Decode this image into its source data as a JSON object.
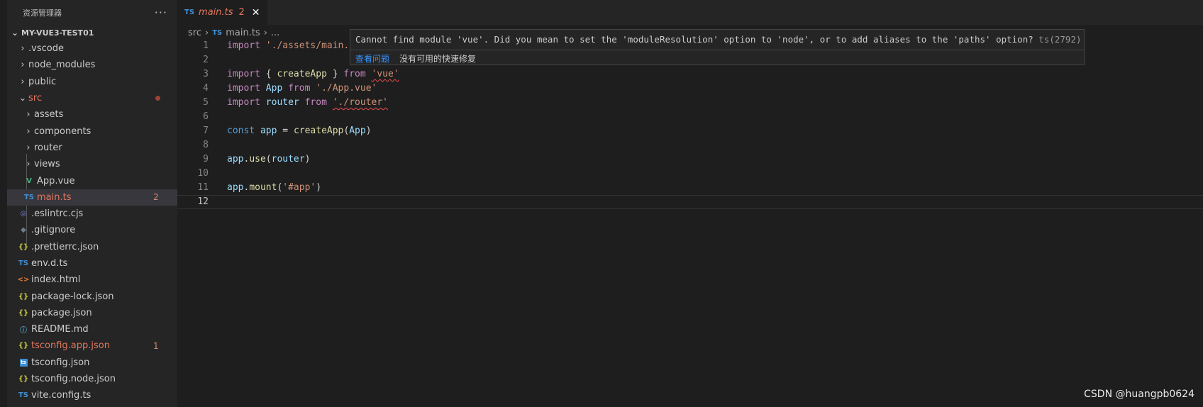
{
  "explorer": {
    "title": "资源管理器",
    "more": "···",
    "project": "MY-VUE3-TEST01",
    "items": [
      {
        "label": ".vscode",
        "type": "folder",
        "depth": 0
      },
      {
        "label": "node_modules",
        "type": "folder",
        "depth": 0
      },
      {
        "label": "public",
        "type": "folder",
        "depth": 0
      },
      {
        "label": "src",
        "type": "folder-open",
        "depth": 0
      },
      {
        "label": "assets",
        "type": "folder",
        "depth": 1
      },
      {
        "label": "components",
        "type": "folder",
        "depth": 1
      },
      {
        "label": "router",
        "type": "folder",
        "depth": 1
      },
      {
        "label": "views",
        "type": "folder",
        "depth": 1
      },
      {
        "label": "App.vue",
        "icon": "V",
        "depth": 1
      },
      {
        "label": "main.ts",
        "icon": "TS",
        "badge": "2",
        "depth": 1
      },
      {
        "label": ".eslintrc.cjs",
        "icon": "◎",
        "depth": 0
      },
      {
        "label": ".gitignore",
        "icon": "◆",
        "depth": 0
      },
      {
        "label": ".prettierrc.json",
        "icon": "{}",
        "depth": 0
      },
      {
        "label": "env.d.ts",
        "icon": "TS",
        "depth": 0
      },
      {
        "label": "index.html",
        "icon": "<>",
        "depth": 0
      },
      {
        "label": "package-lock.json",
        "icon": "{}",
        "depth": 0
      },
      {
        "label": "package.json",
        "icon": "{}",
        "depth": 0
      },
      {
        "label": "README.md",
        "icon": "ⓘ",
        "depth": 0
      },
      {
        "label": "tsconfig.app.json",
        "icon": "{}",
        "badge": "1",
        "depth": 0
      },
      {
        "label": "tsconfig.json",
        "icon": "ts",
        "depth": 0
      },
      {
        "label": "tsconfig.node.json",
        "icon": "{}",
        "depth": 0
      },
      {
        "label": "vite.config.ts",
        "icon": "TS",
        "depth": 0
      }
    ]
  },
  "tab": {
    "icon": "TS",
    "name": "main.ts",
    "count": "2",
    "close": "✕"
  },
  "breadcrumb": {
    "folder": "src",
    "icon": "TS",
    "file": "main.ts",
    "rest": "..."
  },
  "code": {
    "line_numbers": [
      "1",
      "2",
      "3",
      "4",
      "5",
      "6",
      "7",
      "8",
      "9",
      "10",
      "11",
      "12"
    ],
    "l1_kw": "import",
    "l1_str": "'./assets/main.css'",
    "l3_kw": "import",
    "l3_open": "{ ",
    "l3_fn": "createApp",
    "l3_close": " }",
    "l3_from": "from",
    "l3_str": "'vue'",
    "l4_kw": "import",
    "l4_var": "App",
    "l4_from": "from",
    "l4_str": "'./App.vue'",
    "l5_kw": "import",
    "l5_var": "router",
    "l5_from": "from",
    "l5_str": "'./router'",
    "l7_kw": "const",
    "l7_var": "app",
    "l7_eq": " = ",
    "l7_fn": "createApp",
    "l7_p1": "(",
    "l7_arg": "App",
    "l7_p2": ")",
    "l9_var": "app",
    "l9_dot": ".",
    "l9_fn": "use",
    "l9_p1": "(",
    "l9_arg": "router",
    "l9_p2": ")",
    "l11_var": "app",
    "l11_dot": ".",
    "l11_fn": "mount",
    "l11_p1": "(",
    "l11_str": "'#app'",
    "l11_p2": ")"
  },
  "hover": {
    "message": "Cannot find module 'vue'. Did you mean to set the 'moduleResolution' option to 'node', or to add aliases to the 'paths' option?",
    "code": "ts(2792)",
    "view_problem": "查看问题",
    "no_fix": "没有可用的快速修复"
  },
  "watermark": "CSDN @huangpb0624",
  "colors": {
    "error": "#e2765d",
    "link": "#3794ff",
    "ts_icon": "#3f8fd2"
  }
}
